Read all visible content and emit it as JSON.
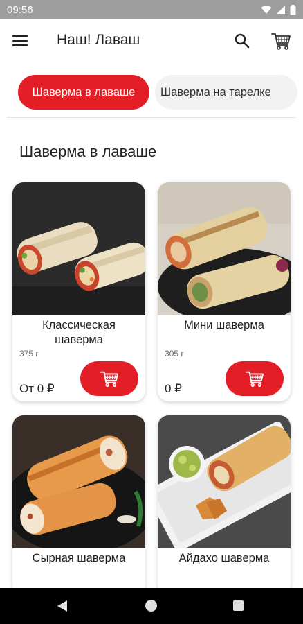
{
  "status_bar": {
    "time": "09:56"
  },
  "app_bar": {
    "title": "Наш! Лаваш"
  },
  "tabs": [
    {
      "label": "Шаверма в лаваше",
      "active": true
    },
    {
      "label": "Шаверма на тарелке",
      "active": false
    }
  ],
  "section_title": "Шаверма в лаваше",
  "products": [
    {
      "name": "Классическая шаверма",
      "weight": "375 г",
      "price": "От 0 ₽"
    },
    {
      "name": "Мини шаверма",
      "weight": "305 г",
      "price": "0 ₽"
    },
    {
      "name": "Сырная шаверма"
    },
    {
      "name": "Айдахо шаверма"
    }
  ],
  "colors": {
    "accent": "#e41e26",
    "status_bar": "#9e9e9e",
    "chip_inactive": "#f2f2f2"
  }
}
